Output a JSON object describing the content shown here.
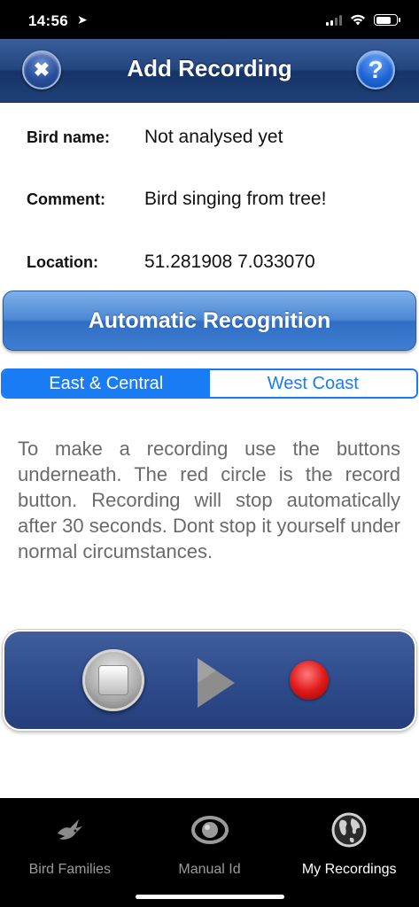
{
  "status_bar": {
    "time": "14:56"
  },
  "nav": {
    "title": "Add Recording",
    "close_label": "✖",
    "help_label": "?"
  },
  "info": {
    "bird_name_label": "Bird name:",
    "bird_name_value": "Not analysed yet",
    "comment_label": "Comment:",
    "comment_value": "Bird singing from tree!",
    "location_label": "Location:",
    "location_value": "51.281908 7.033070"
  },
  "auto_recognition_label": "Automatic Recognition",
  "region_tabs": [
    {
      "label": "East & Central",
      "selected": true
    },
    {
      "label": "West Coast",
      "selected": false
    }
  ],
  "instructions": "To make a recording use the buttons underneath. The red circle is the record button. Recording will stop automatically after 30 seconds. Dont stop it yourself under normal circumstances.",
  "player": {
    "stop_icon": "stop-icon",
    "play_icon": "play-icon",
    "record_icon": "record-icon"
  },
  "tab_bar": {
    "items": [
      {
        "label": "Bird Families",
        "icon": "bird-icon",
        "selected": false
      },
      {
        "label": "Manual Id",
        "icon": "eye-icon",
        "selected": false
      },
      {
        "label": "My Recordings",
        "icon": "globe-icon",
        "selected": true
      }
    ]
  },
  "colors": {
    "nav": "#23457f",
    "accent": "#1a7cf5",
    "record": "#e01b1b"
  }
}
